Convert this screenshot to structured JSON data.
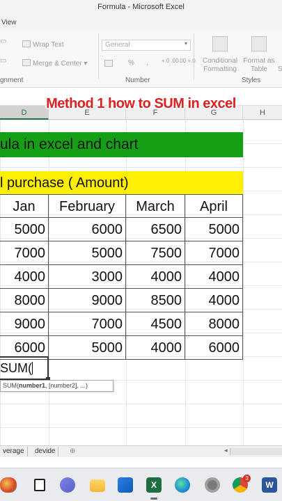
{
  "window": {
    "title": "Formula - Microsoft Excel",
    "tab": "View"
  },
  "ribbon": {
    "wrap_text": "Wrap Text",
    "merge_center": "Merge & Center",
    "merge_caret": "▾",
    "number_format": "General",
    "number_symbols": {
      "currency": "$",
      "percent": "%",
      "comma": ",",
      "inc_dec": "+.0 .00",
      "dec_dec": ".00 +.0"
    },
    "conditional_formatting": "Conditional Formatting",
    "format_as_table": "Format as Table",
    "cell_styles_partial": "S",
    "groups": {
      "alignment": "gnment",
      "number": "Number",
      "styles": "Styles"
    }
  },
  "overlay_title": "Method 1 how to SUM in excel",
  "columns": [
    {
      "label": "D",
      "selected": true
    },
    {
      "label": "E",
      "selected": false
    },
    {
      "label": "F",
      "selected": false
    },
    {
      "label": "G",
      "selected": false
    },
    {
      "label": "H",
      "selected": false
    }
  ],
  "sheet": {
    "banner_green": "ula in excel and chart",
    "banner_yellow": "l purchase ( Amount)",
    "headers": [
      "Jan",
      "February",
      "March",
      "April"
    ],
    "rows": [
      [
        "5000",
        "6000",
        "6500",
        "5000"
      ],
      [
        "7000",
        "5000",
        "7500",
        "7000"
      ],
      [
        "4000",
        "3000",
        "4000",
        "4000"
      ],
      [
        "8000",
        "9000",
        "8500",
        "4000"
      ],
      [
        "9000",
        "7000",
        "4500",
        "8000"
      ],
      [
        "6000",
        "5000",
        "4000",
        "6000"
      ]
    ],
    "formula_entry": "SUM(",
    "tooltip": {
      "fn": "SUM(",
      "arg1": "number1",
      "rest": ", [number2], ...)"
    }
  },
  "sheet_tabs": [
    "verage",
    "devide"
  ],
  "colors": {
    "green": "#14a014",
    "yellow": "#ffef00",
    "accent": "#217346",
    "red_title": "#e02020"
  },
  "taskbar": {
    "icons": [
      "fruit-photo-icon",
      "task-view-icon",
      "teams-chat-icon",
      "file-explorer-icon",
      "store-icon",
      "excel-icon",
      "edge-icon",
      "settings-icon",
      "chrome-icon",
      "word-icon"
    ],
    "chrome_badge": "3"
  }
}
